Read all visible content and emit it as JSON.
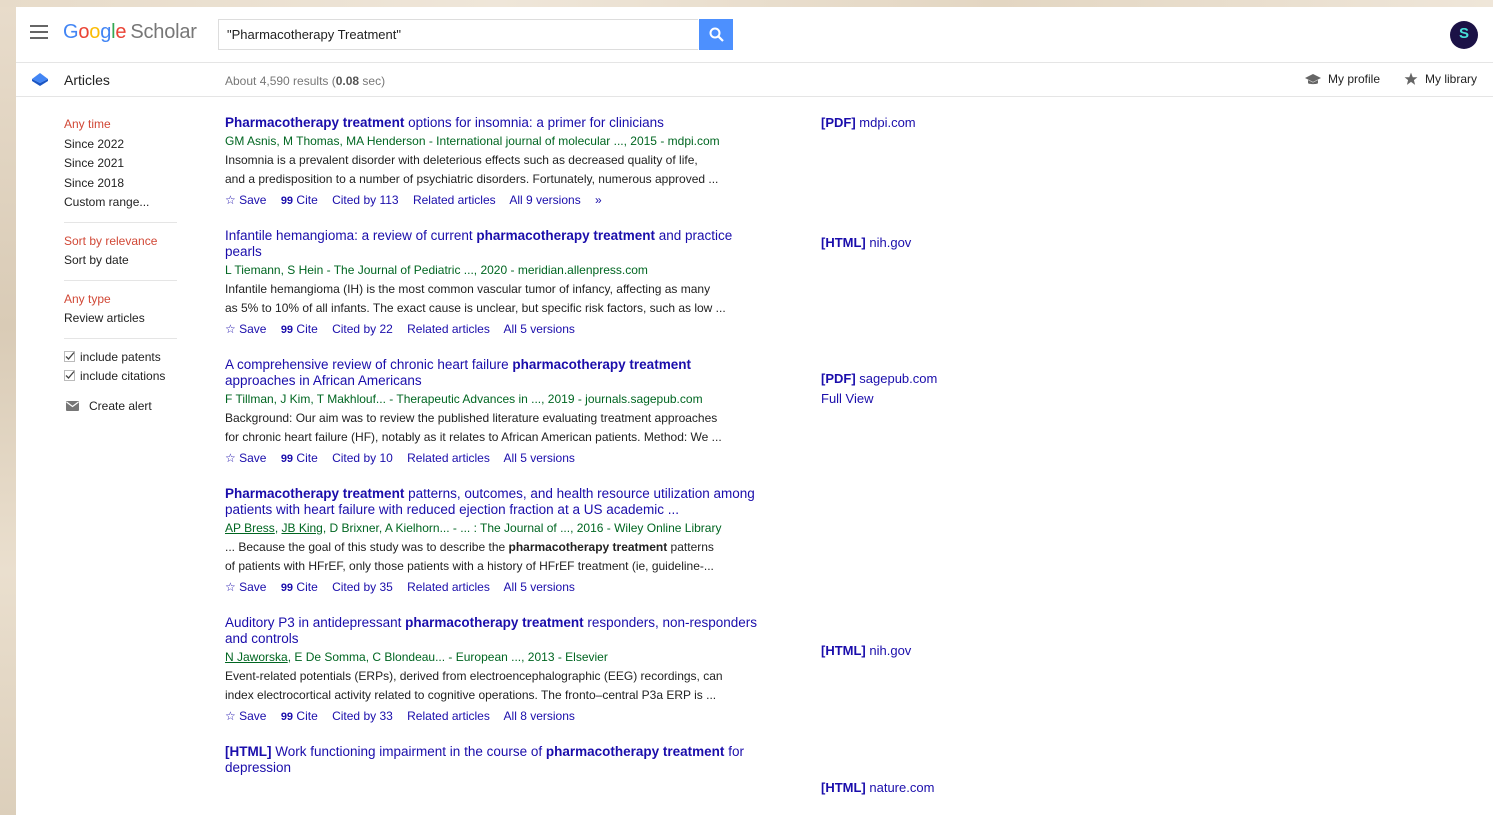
{
  "header": {
    "logo": {
      "g1": "G",
      "g2": "o",
      "g3": "o",
      "g4": "g",
      "g5": "l",
      "g6": "e",
      "scholar": "Scholar"
    },
    "search_value": "\"Pharmacotherapy Treatment\"",
    "avatar_letter": "S"
  },
  "subheader": {
    "articles_label": "Articles",
    "results_prefix": "About 4,590 results (",
    "results_time": "0.08",
    "results_suffix": " sec)",
    "my_profile": "My profile",
    "my_library": "My library"
  },
  "sidebar": {
    "time": [
      "Any time",
      "Since 2022",
      "Since 2021",
      "Since 2018",
      "Custom range..."
    ],
    "sort": [
      "Sort by relevance",
      "Sort by date"
    ],
    "type": [
      "Any type",
      "Review articles"
    ],
    "checks": [
      "include patents",
      "include citations"
    ],
    "create_alert": "Create alert"
  },
  "actions": {
    "save": "Save",
    "cite": "Cite",
    "related": "Related articles",
    "more": "»"
  },
  "results": [
    {
      "t1": "Pharmacotherapy treatment",
      "t2": " options for insomnia: a primer for clinicians",
      "authors": "GM Asnis, M Thomas, MA Henderson - International journal of molecular ..., 2015 - mdpi.com",
      "snip1": "Insomnia is a prevalent disorder with deleterious effects such as decreased quality of life,",
      "snip2": "and a predisposition to a number of psychiatric disorders. Fortunately, numerous approved ...",
      "cited": "Cited by 113",
      "versions": "All 9 versions"
    },
    {
      "t1": "Infantile hemangioma: a review of current ",
      "t2": "pharmacotherapy treatment",
      "t3": " and practice pearls",
      "authors": "L Tiemann, S Hein - The Journal of Pediatric ..., 2020 - meridian.allenpress.com",
      "snip1": "Infantile hemangioma (IH) is the most common vascular tumor of infancy, affecting as many",
      "snip2": "as 5% to 10% of all infants. The exact cause is unclear, but specific risk factors, such as low ...",
      "cited": "Cited by 22",
      "versions": "All 5 versions"
    },
    {
      "t1": "A comprehensive review of chronic heart failure ",
      "t2": "pharmacotherapy treatment",
      "t3": " approaches in African Americans",
      "authors": "F Tillman, J Kim, T Makhlouf... - Therapeutic Advances in ..., 2019 - journals.sagepub.com",
      "snip1": "Background: Our aim was to review the published literature evaluating treatment approaches",
      "snip2": "for chronic heart failure (HF), notably as it relates to African American patients. Method: We ...",
      "cited": "Cited by 10",
      "versions": "All 5 versions"
    },
    {
      "t1": "Pharmacotherapy treatment",
      "t2": " patterns, outcomes, and health resource utilization among patients with heart failure with reduced ejection fraction at a US academic ...",
      "a1": "AP Bress",
      "a2": "JB King",
      "a3": ", D Brixner, A Kielhorn... - ... : The Journal of ..., 2016 - Wiley Online Library",
      "snip1a": "... Because the goal of this study was to describe the ",
      "snip1b": "pharmacotherapy treatment",
      "snip1c": " patterns",
      "snip2": "of patients with HFrEF, only those patients with a history of HFrEF treatment (ie, guideline-...",
      "cited": "Cited by 35",
      "versions": "All 5 versions"
    },
    {
      "t1": "Auditory P3 in antidepressant ",
      "t2": "pharmacotherapy treatment",
      "t3": " responders, non-responders and controls",
      "a1": "N Jaworska",
      "a3": ", E De Somma, C Blondeau... - European ..., 2013 - Elsevier",
      "snip1": "Event-related potentials (ERPs), derived from electroencephalographic (EEG) recordings, can",
      "snip2": "index electrocortical activity related to cognitive operations. The fronto–central P3a ERP is ...",
      "cited": "Cited by 33",
      "versions": "All 8 versions"
    },
    {
      "tag": "[HTML]",
      "t1": " Work functioning impairment in the course of ",
      "t2": "pharmacotherapy treatment",
      "t3": " for depression"
    }
  ],
  "side_links": [
    {
      "tag": "[PDF]",
      "site": " mdpi.com"
    },
    {
      "tag": "[HTML]",
      "site": " nih.gov"
    },
    {
      "tag": "[PDF]",
      "site": " sagepub.com",
      "extra": "Full View"
    },
    {
      "tag": "[HTML]",
      "site": " nih.gov"
    },
    {
      "tag": "[HTML]",
      "site": " nature.com"
    }
  ],
  "colors": {
    "link": "#1a0dab",
    "author_green": "#006621",
    "active_red": "#d14836",
    "search_blue": "#4d90fe"
  }
}
